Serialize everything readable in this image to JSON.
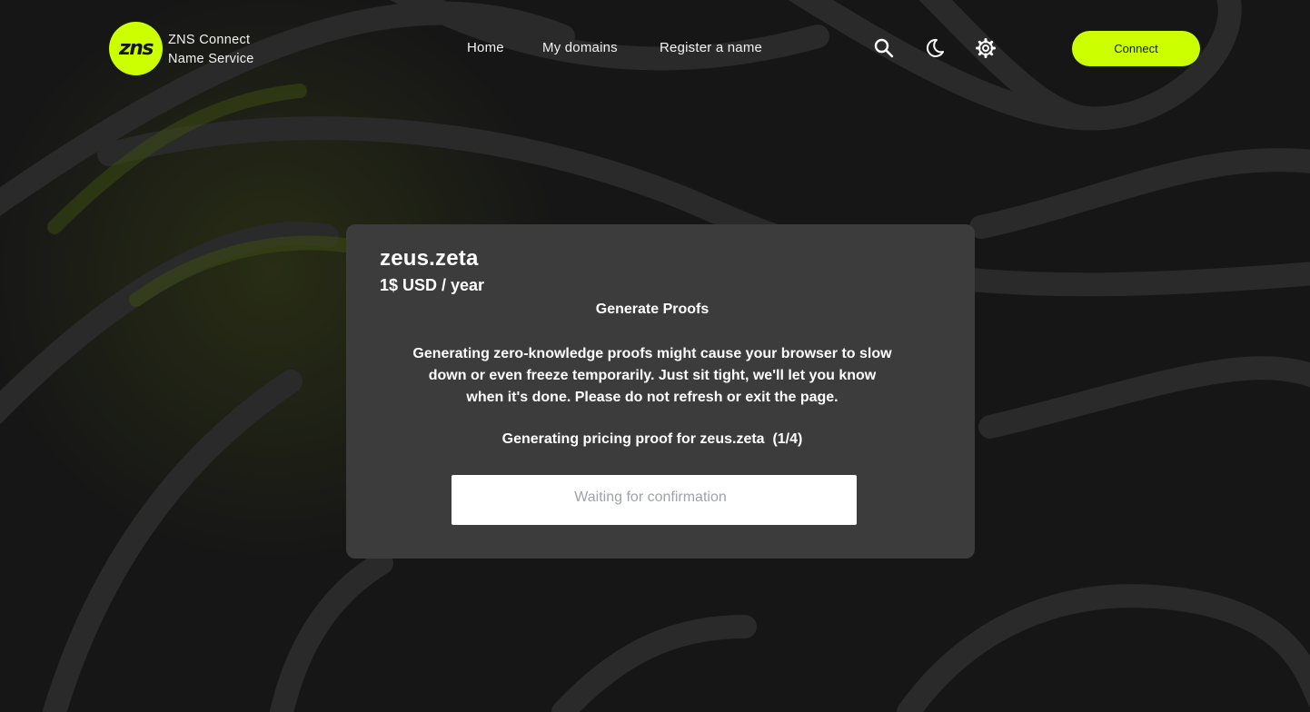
{
  "header": {
    "logo_text": "zns",
    "brand_line1": "ZNS Connect",
    "brand_line2": "Name Service",
    "nav": [
      {
        "label": "Home"
      },
      {
        "label": "My domains"
      },
      {
        "label": "Register a name"
      }
    ],
    "icons": [
      "search-icon",
      "moon-icon",
      "gear-icon"
    ],
    "connect_label": "Connect"
  },
  "card": {
    "domain": "zeus.zeta",
    "price": "1$ USD / year",
    "title": "Generate Proofs",
    "description": "Generating zero-knowledge proofs might cause your browser to slow down or even freeze temporarily. Just sit tight, we'll let you know when it's done. Please do not refresh or exit the page.",
    "progress": "Generating pricing proof for zeus.zeta  (1/4)",
    "status": "Waiting for confirmation"
  },
  "colors": {
    "accent": "#ccff00",
    "background": "#161616",
    "card": "#3c3c3c",
    "status_text": "#9ea3a8"
  }
}
